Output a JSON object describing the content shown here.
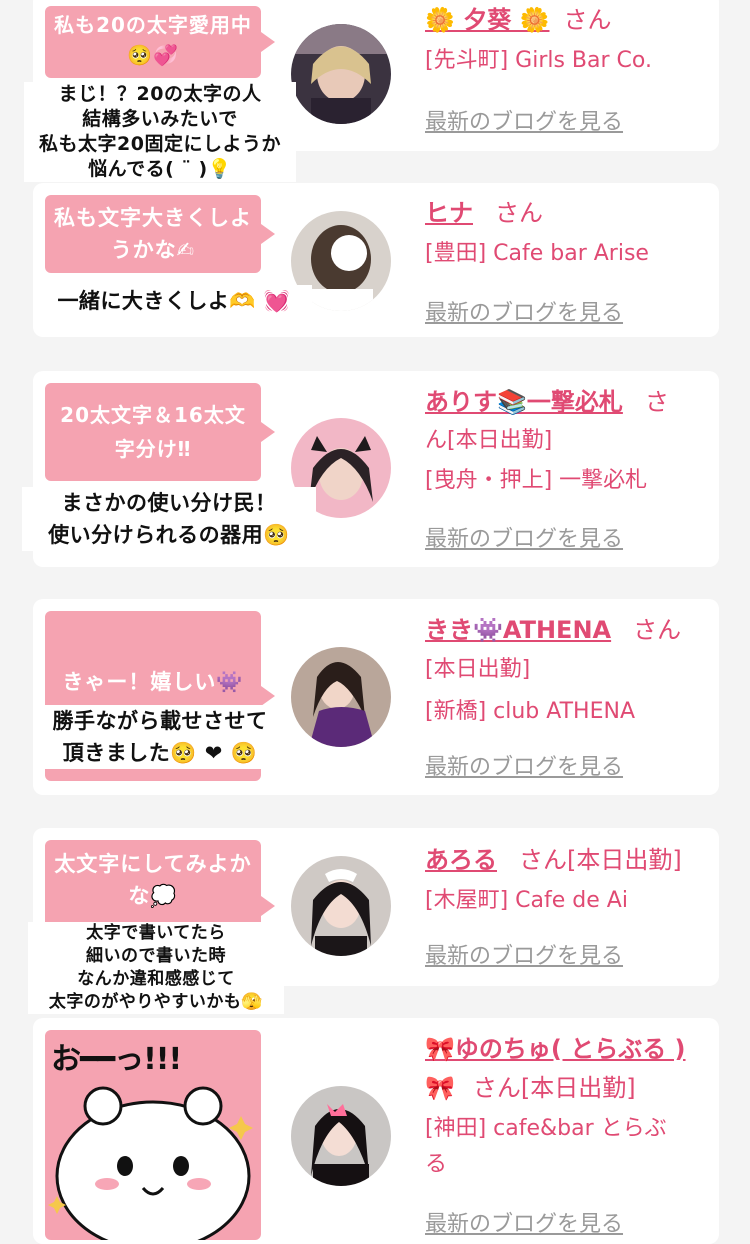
{
  "cards": [
    {
      "bubble": "私も20の太字愛用中🥺💞",
      "caption": [
        "まじ！？20の太字の人",
        "結構多いみたいで",
        "私も太字20固定にしようか",
        "悩んでる( ¨ )💡"
      ],
      "name": "🌼 夕葵 🌼",
      "san": "さん",
      "lines": [
        "[先斗町] Girls Bar Co."
      ],
      "blog": "最新のブログを見る"
    },
    {
      "bubble": "私も文字大きくしようかな✍",
      "caption": [
        "一緒に大きくしよ🫶 💓"
      ],
      "name": "ヒナ",
      "san": "さん",
      "lines": [
        "[豊田] Cafe bar Arise"
      ],
      "blog": "最新のブログを見る"
    },
    {
      "bubble": "20太文字＆16太文字分け‼",
      "caption": [
        "まさかの使い分け民！",
        "使い分けられるの器用🥺"
      ],
      "name": "ありす📚一撃必札",
      "san": "さ",
      "lines": [
        "ん[本日出勤]",
        "[曳舟・押上] 一撃必札"
      ],
      "blog": "最新のブログを見る"
    },
    {
      "bubble": "きゃー！嬉しい👾",
      "caption": [
        "勝手ながら載せさせて",
        "頂きました🥺 ❤ 🥺"
      ],
      "name": "きき👾ATHENA",
      "san": "さん",
      "lines": [
        "[本日出勤]",
        "[新橋] club ATHENA"
      ],
      "blog": "最新のブログを見る"
    },
    {
      "bubble": "太文字にしてみよかな💭",
      "caption": [
        "太字で書いてたら",
        "細いので書いた時",
        "なんか違和感感じて",
        "太字のがやりやすいかも🫣"
      ],
      "name": "あろる",
      "san": "さん[本日出勤]",
      "lines": [
        "[木屋町] Cafe de Ai"
      ],
      "blog": "最新のブログを見る"
    },
    {
      "sticker_text": "お━━っ!!!",
      "name": "🎀ゆのちゅ( とらぶる )",
      "name2": "🎀",
      "san": "さん[本日出勤]",
      "lines": [
        "[神田] cafe&bar とらぶ",
        "る"
      ],
      "blog": "最新のブログを見る"
    }
  ]
}
